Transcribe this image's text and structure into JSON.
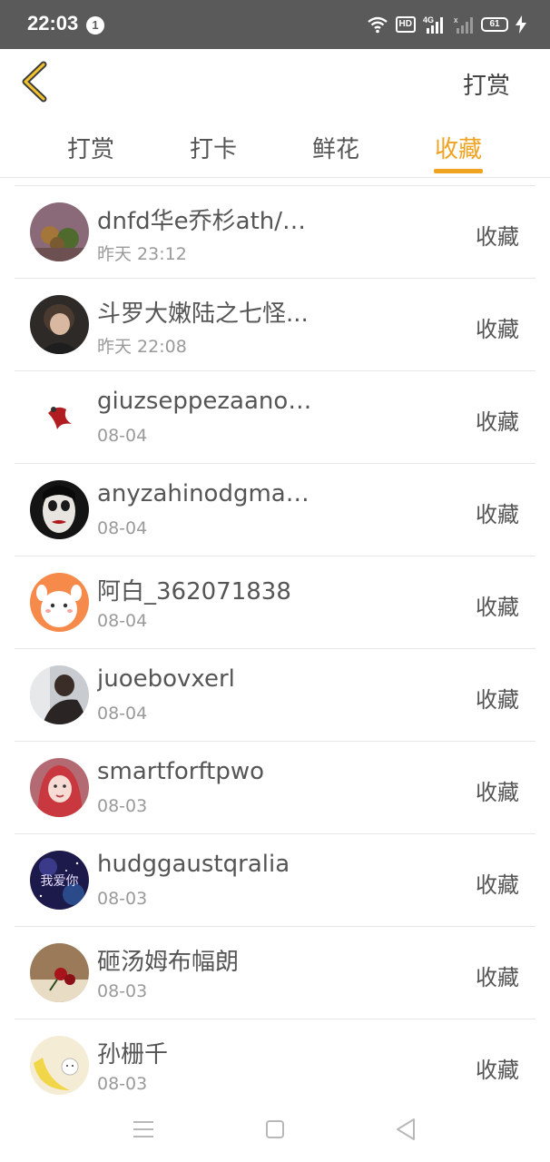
{
  "status_bar": {
    "time": "22:03",
    "notification_count": "1",
    "hd_label": "HD",
    "network_label": "4G",
    "battery": "61"
  },
  "header": {
    "back_icon": "chevron-left-icon",
    "action_label": "打赏"
  },
  "tabs": [
    {
      "label": "打赏",
      "active": false
    },
    {
      "label": "打卡",
      "active": false
    },
    {
      "label": "鲜花",
      "active": false
    },
    {
      "label": "收藏",
      "active": true
    }
  ],
  "accent_color": "#f0a221",
  "list": [
    {
      "name": "dnfd华e乔杉ath/k...",
      "time": "昨天 23:12",
      "action": "收藏"
    },
    {
      "name": "斗罗大嫩陆之七怪...",
      "time": "昨天 22:08",
      "action": "收藏"
    },
    {
      "name": "giuzseppezaanotx...",
      "time": "08-04",
      "action": "收藏"
    },
    {
      "name": "anyzahinodgmarc...",
      "time": "08-04",
      "action": "收藏"
    },
    {
      "name": "阿白_362071838",
      "time": "08-04",
      "action": "收藏"
    },
    {
      "name": "juoebovxerl",
      "time": "08-04",
      "action": "收藏"
    },
    {
      "name": "smartforftpwo",
      "time": "08-03",
      "action": "收藏"
    },
    {
      "name": "hudggaustqralia",
      "time": "08-03",
      "action": "收藏"
    },
    {
      "name": "砸汤姆布幅朗",
      "time": "08-03",
      "action": "收藏"
    },
    {
      "name": "孙栅千",
      "time": "08-03",
      "action": "收藏"
    }
  ],
  "avatar_8_text": "我爱你",
  "nav_bar": {
    "menu_icon": "menu-icon",
    "home_icon": "square-home-icon",
    "back_icon": "triangle-back-icon"
  }
}
